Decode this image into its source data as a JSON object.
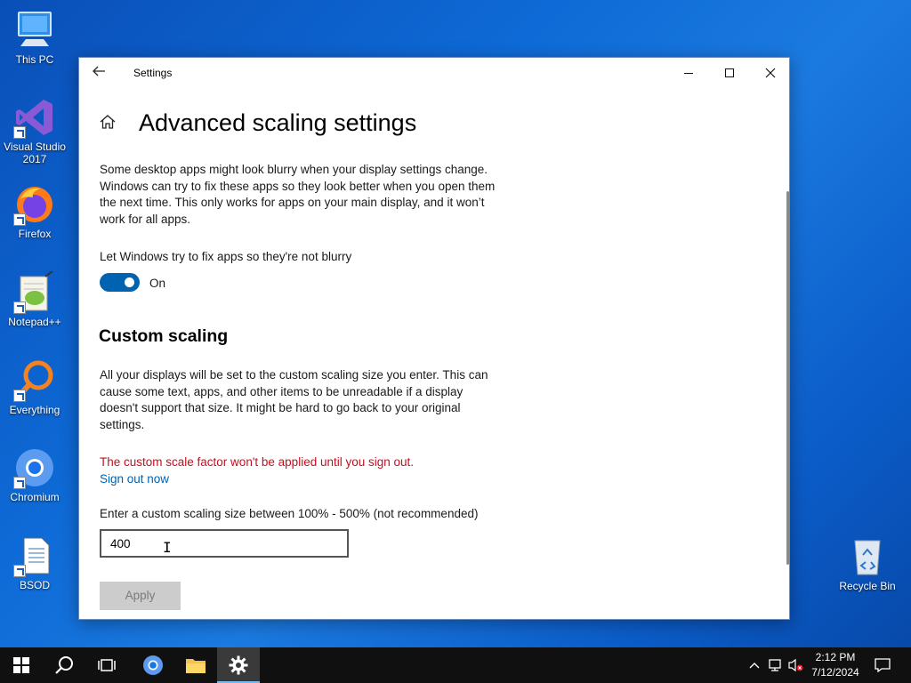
{
  "desktop": {
    "icons": [
      {
        "label": "This PC",
        "icon": "computer-icon"
      },
      {
        "label": "Visual Studio 2017",
        "icon": "visual-studio-icon"
      },
      {
        "label": "Firefox",
        "icon": "firefox-icon"
      },
      {
        "label": "Notepad++",
        "icon": "notepadpp-icon"
      },
      {
        "label": "Everything",
        "icon": "everything-search-icon"
      },
      {
        "label": "Chromium",
        "icon": "chromium-icon"
      },
      {
        "label": "BSOD",
        "icon": "document-icon"
      },
      {
        "label": "Recycle Bin",
        "icon": "recycle-bin-icon"
      }
    ]
  },
  "window": {
    "title": "Settings",
    "page_title": "Advanced scaling settings",
    "description": "Some desktop apps might look blurry when your display settings change. Windows can try to fix these apps so they look better when you open them the next time. This only works for apps on your main display, and it won’t work for all apps.",
    "toggle_label": "Let Windows try to fix apps so they're not blurry",
    "toggle_state": "On",
    "section_title": "Custom scaling",
    "custom_description": "All your displays will be set to the custom scaling size you enter. This can cause some text, apps, and other items to be unreadable if a display doesn't support that size. It might be hard to go back to your original settings.",
    "warning": "The custom scale factor won't be applied until you sign out.",
    "signout_link": "Sign out now",
    "input_label": "Enter a custom scaling size between 100% - 500% (not recommended)",
    "input_value": "400",
    "apply_label": "Apply"
  },
  "taskbar": {
    "time": "2:12 PM",
    "date": "7/12/2024"
  },
  "colors": {
    "accent": "#0063b1",
    "warning": "#c50f1f",
    "taskbar": "#101010"
  }
}
